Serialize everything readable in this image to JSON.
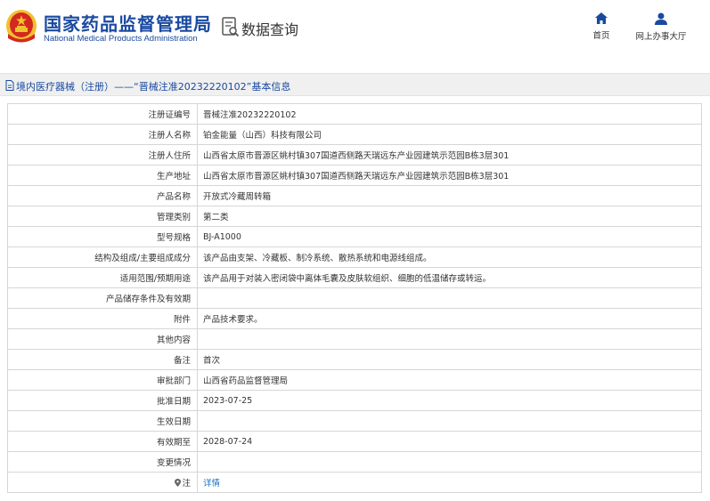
{
  "header": {
    "org_name_cn": "国家药品监督管理局",
    "org_name_en": "National Medical Products Administration",
    "section_title": "数据查询",
    "nav": {
      "home_label": "首页",
      "online_office_label": "网上办事大厅"
    }
  },
  "breadcrumb": {
    "text": "境内医疗器械（注册）——“晋械注准20232220102”基本信息"
  },
  "colors": {
    "brand_blue": "#1a4aa0",
    "link_blue": "#1a6fc4",
    "emblem_red": "#d22a1e",
    "emblem_gold": "#f2c12e"
  },
  "detail_rows": [
    {
      "key": "注册证编号",
      "value": "晋械注准20232220102"
    },
    {
      "key": "注册人名称",
      "value": "铂金能量（山西）科技有限公司"
    },
    {
      "key": "注册人住所",
      "value": "山西省太原市晋源区姚村镇307国道西侧路天瑞远东产业园建筑示范园B栋3层301"
    },
    {
      "key": "生产地址",
      "value": "山西省太原市晋源区姚村镇307国道西侧路天瑞远东产业园建筑示范园B栋3层301"
    },
    {
      "key": "产品名称",
      "value": "开放式冷藏周转箱"
    },
    {
      "key": "管理类别",
      "value": "第二类"
    },
    {
      "key": "型号规格",
      "value": "BJ-A1000"
    },
    {
      "key": "结构及组成/主要组成成分",
      "value": "该产品由支架、冷藏板、制冷系统、散热系统和电源线组成。"
    },
    {
      "key": "适用范围/预期用途",
      "value": "该产品用于对装入密闭袋中离体毛囊及皮肤软组织、细胞的低温储存或转运。"
    },
    {
      "key": "产品储存条件及有效期",
      "value": ""
    },
    {
      "key": "附件",
      "value": "产品技术要求。"
    },
    {
      "key": "其他内容",
      "value": ""
    },
    {
      "key": "备注",
      "value": "首次"
    },
    {
      "key": "审批部门",
      "value": "山西省药品监督管理局"
    },
    {
      "key": "批准日期",
      "value": "2023-07-25"
    },
    {
      "key": "生效日期",
      "value": ""
    },
    {
      "key": "有效期至",
      "value": "2028-07-24"
    },
    {
      "key": "变更情况",
      "value": ""
    }
  ],
  "note_row": {
    "key": "注",
    "link_label": "详情"
  }
}
